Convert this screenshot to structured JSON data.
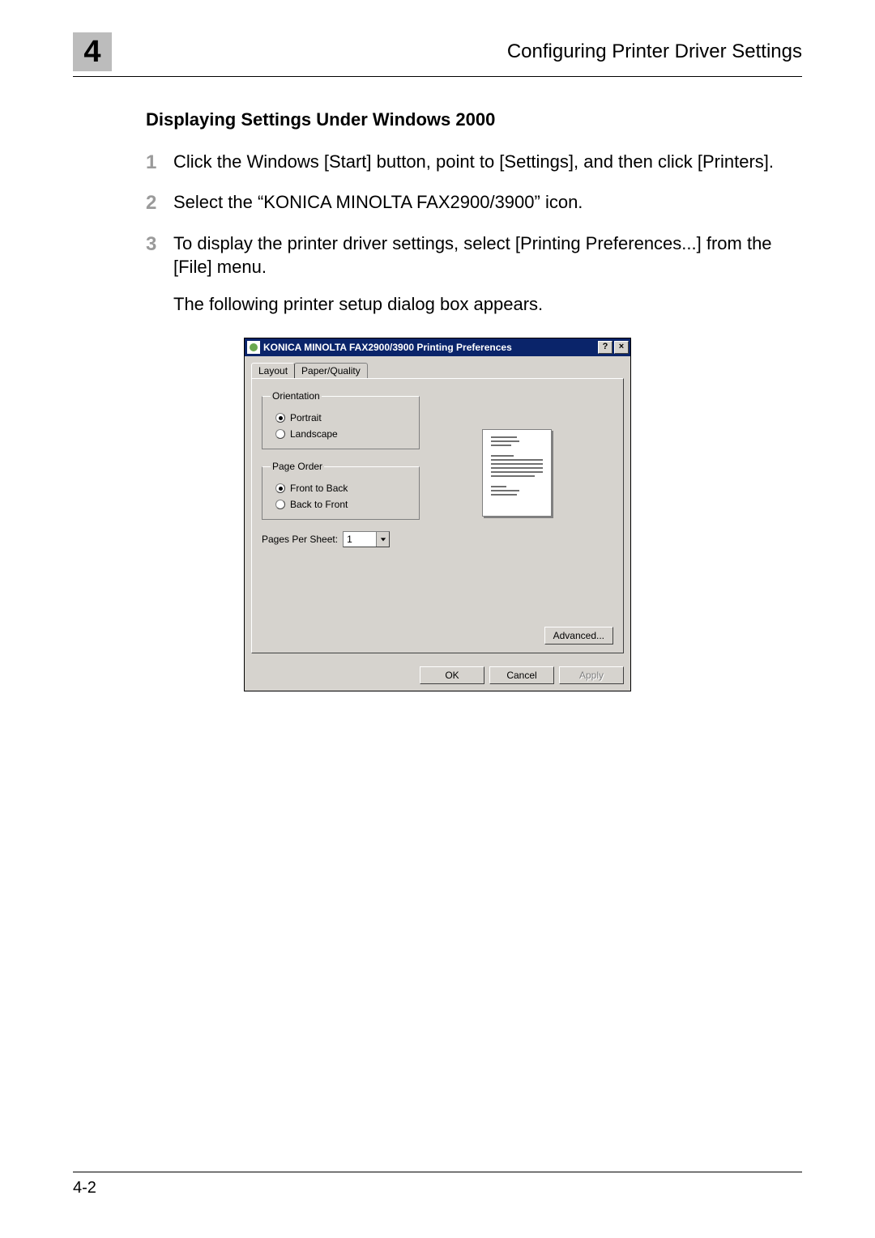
{
  "header": {
    "chapter_number": "4",
    "title": "Configuring Printer Driver Settings"
  },
  "section_title": "Displaying Settings Under Windows 2000",
  "steps": [
    {
      "num": "1",
      "text": "Click the Windows [Start] button, point to [Settings], and then click [Printers]."
    },
    {
      "num": "2",
      "text": "Select the “KONICA MINOLTA FAX2900/3900” icon."
    },
    {
      "num": "3",
      "text": "To display the printer driver settings, select [Printing Preferences...] from the [File] menu."
    }
  ],
  "step_note": "The following printer setup dialog box appears.",
  "dialog": {
    "title": "KONICA MINOLTA FAX2900/3900 Printing Preferences",
    "help_btn": "?",
    "close_btn": "×",
    "tabs": {
      "layout": "Layout",
      "paper_quality": "Paper/Quality"
    },
    "orientation": {
      "legend": "Orientation",
      "portrait": "Portrait",
      "landscape": "Landscape"
    },
    "page_order": {
      "legend": "Page Order",
      "front_to_back": "Front to Back",
      "back_to_front": "Back to Front"
    },
    "pages_per_sheet": {
      "label": "Pages Per Sheet:",
      "value": "1"
    },
    "buttons": {
      "advanced": "Advanced...",
      "ok": "OK",
      "cancel": "Cancel",
      "apply": "Apply"
    }
  },
  "footer": {
    "page_number": "4-2"
  }
}
